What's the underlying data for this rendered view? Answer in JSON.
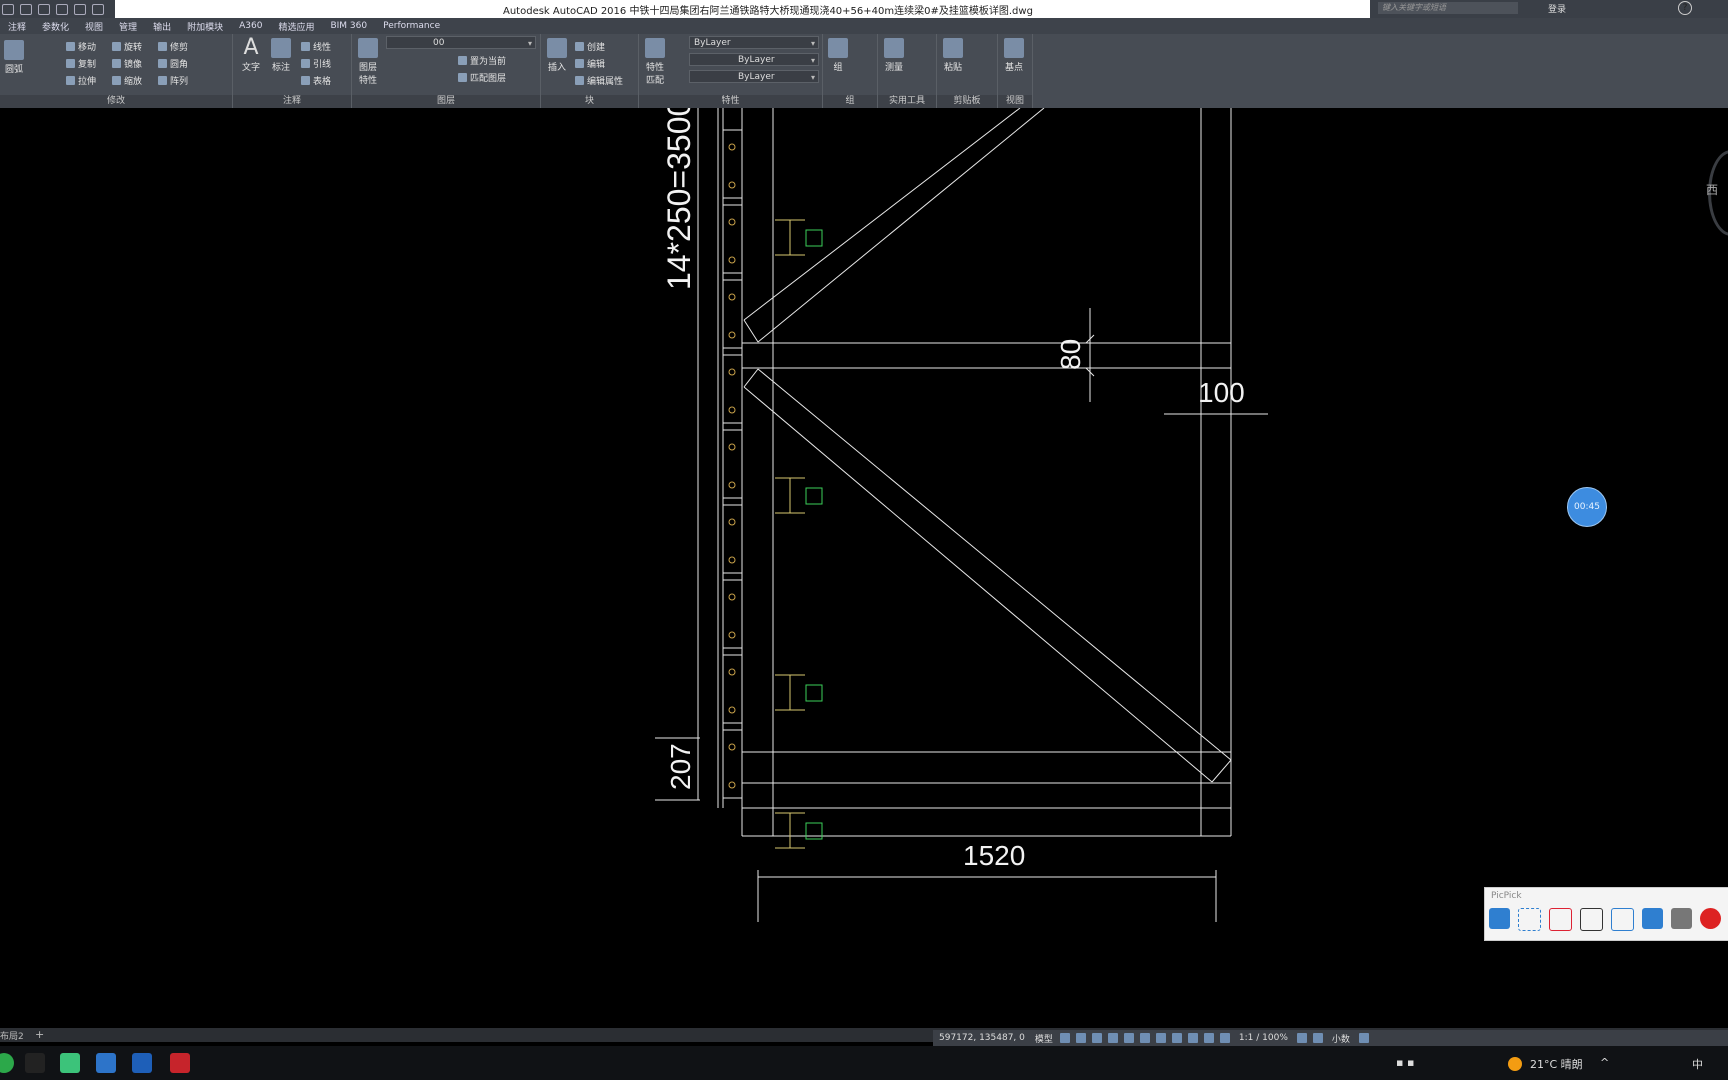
{
  "window": {
    "title": "Autodesk AutoCAD 2016     中铁十四局集团右阿兰通铁路特大桥现通现浇40+56+40m连续梁0#及挂篮模板详图.dwg",
    "search_placeholder": "键入关键字或短语",
    "login": "登录",
    "help": "?"
  },
  "tabs": [
    "注释",
    "参数化",
    "视图",
    "管理",
    "输出",
    "附加模块",
    "A360",
    "精选应用",
    "BIM 360",
    "Performance"
  ],
  "ribbon": {
    "modify": {
      "arc": "圆弧",
      "move": "移动",
      "rotate": "旋转",
      "trim": "修剪",
      "copy": "复制",
      "mirror": "镜像",
      "fillet": "圆角",
      "stretch": "拉伸",
      "scale": "缩放",
      "array": "阵列",
      "label": "修改"
    },
    "annotation": {
      "text": "文字",
      "dimension": "标注",
      "linear": "线性",
      "leader": "引线",
      "table": "表格",
      "label": "注释"
    },
    "layers": {
      "layer_props": "图层\n特性",
      "current_layer": "00",
      "set_current": "置为当前",
      "match_layer": "匹配图层",
      "label": "图层"
    },
    "block": {
      "insert": "插入",
      "create": "创建",
      "edit": "编辑",
      "edit_attr": "编辑属性",
      "label": "块"
    },
    "properties": {
      "match": "特性\n匹配",
      "color": "ByLayer",
      "linetype": "ByLayer",
      "lineweight": "ByLayer",
      "label": "特性"
    },
    "groups": {
      "group": "组",
      "label": "组"
    },
    "utilities": {
      "measure": "测量",
      "label": "实用工具"
    },
    "clipboard": {
      "paste": "粘贴",
      "label": "剪贴板"
    },
    "view": {
      "base": "基点",
      "label": "视图"
    }
  },
  "drawing": {
    "dim_vertical_total": "14*250=3500",
    "dim_80": "80",
    "dim_100": "100",
    "dim_207": "207",
    "dim_1520": "1520"
  },
  "timer": "00:45",
  "compass_label": "西",
  "picpick": {
    "title": "PicPick"
  },
  "layout_tab": "布局2",
  "status": {
    "coords": "597172, 135487, 0",
    "model": "模型",
    "scale": "1:1 / 100%",
    "units": "小数"
  },
  "tray": {
    "weather": "21°C  晴朗",
    "ime": "中"
  }
}
